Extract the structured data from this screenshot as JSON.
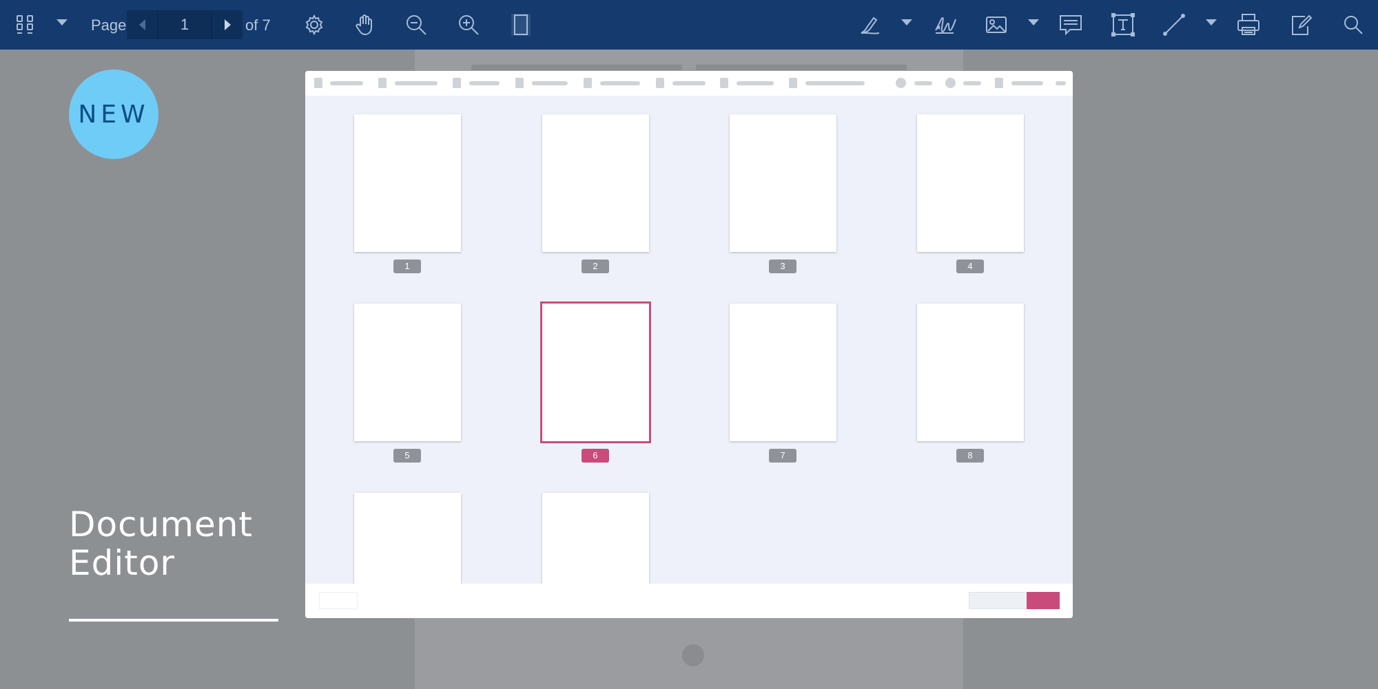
{
  "toolbar": {
    "page_label": "Page",
    "current_page": "1",
    "of_label": "of 7",
    "icons": [
      "grid-view-icon",
      "settings-icon",
      "pan-hand-icon",
      "zoom-out-icon",
      "zoom-in-icon",
      "single-page-icon",
      "pen-icon",
      "signature-icon",
      "image-icon",
      "comment-icon",
      "textbox-icon",
      "line-icon",
      "print-icon",
      "edit-icon",
      "search-icon"
    ]
  },
  "promo": {
    "badge": "NEW",
    "headline": "Document Editor"
  },
  "colors": {
    "toolbar_bg": "#143a6e",
    "badge_bg": "#6fccf7",
    "accent": "#c84b7c",
    "page_bg": "#8d9093"
  },
  "thumbnails": {
    "selected": 6,
    "pages": [
      "1",
      "2",
      "3",
      "4",
      "5",
      "6",
      "7",
      "8"
    ]
  }
}
